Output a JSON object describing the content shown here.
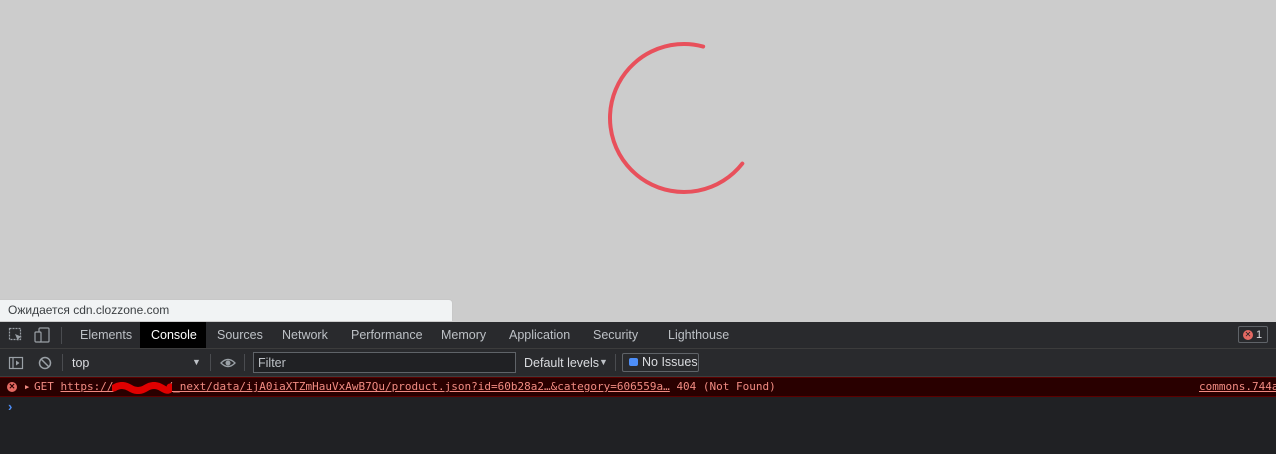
{
  "page": {
    "status_text": "Ожидается cdn.clozzone.com",
    "spinner_color": "#e8505b",
    "background": "#cccccc"
  },
  "devtools": {
    "icons": {
      "inspect": "inspect-element-icon",
      "device": "device-toolbar-icon"
    },
    "tabs": [
      {
        "label": "Elements",
        "active": false
      },
      {
        "label": "Console",
        "active": true
      },
      {
        "label": "Sources",
        "active": false
      },
      {
        "label": "Network",
        "active": false
      },
      {
        "label": "Performance",
        "active": false
      },
      {
        "label": "Memory",
        "active": false
      },
      {
        "label": "Application",
        "active": false
      },
      {
        "label": "Security",
        "active": false
      },
      {
        "label": "Lighthouse",
        "active": false
      }
    ],
    "error_count": "1",
    "toolbar": {
      "context": "top",
      "filter_placeholder": "Filter",
      "levels": "Default levels",
      "issues": "No Issues"
    },
    "console": {
      "error": {
        "method": "GET",
        "url_start": "https://",
        "url_end": "/_next/data/ijA0iaXTZmHauVxAwB7Qu/product.json?id=60b28a2…&category=606559a…",
        "status": "404 (Not Found)",
        "source": "commons.744a"
      },
      "prompt": "›"
    }
  }
}
